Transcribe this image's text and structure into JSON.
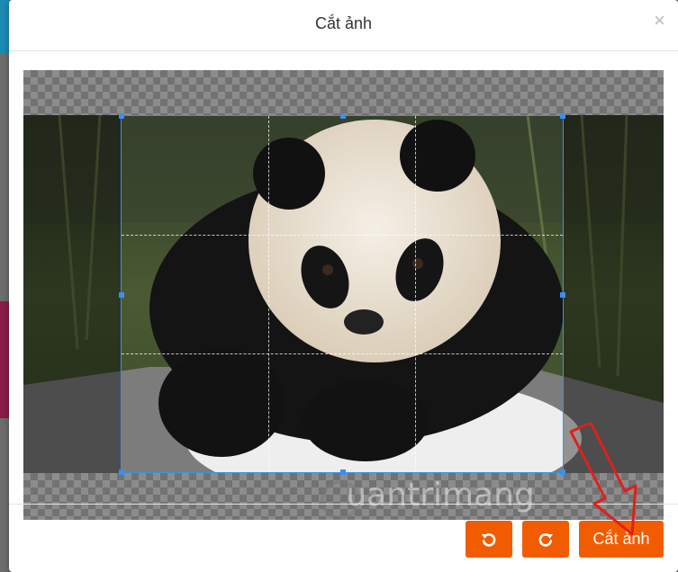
{
  "dialog": {
    "title": "Cắt ảnh",
    "close_icon": "×"
  },
  "image": {
    "subject": "panda",
    "watermark": "uantrimang"
  },
  "buttons": {
    "rotate_left_icon": "rotate-left-icon",
    "rotate_right_icon": "rotate-right-icon",
    "crop_label": "Cắt ảnh"
  },
  "colors": {
    "accent": "#f25c00",
    "crop_border": "#3b8ff0",
    "annotation_arrow": "#e0201b"
  }
}
